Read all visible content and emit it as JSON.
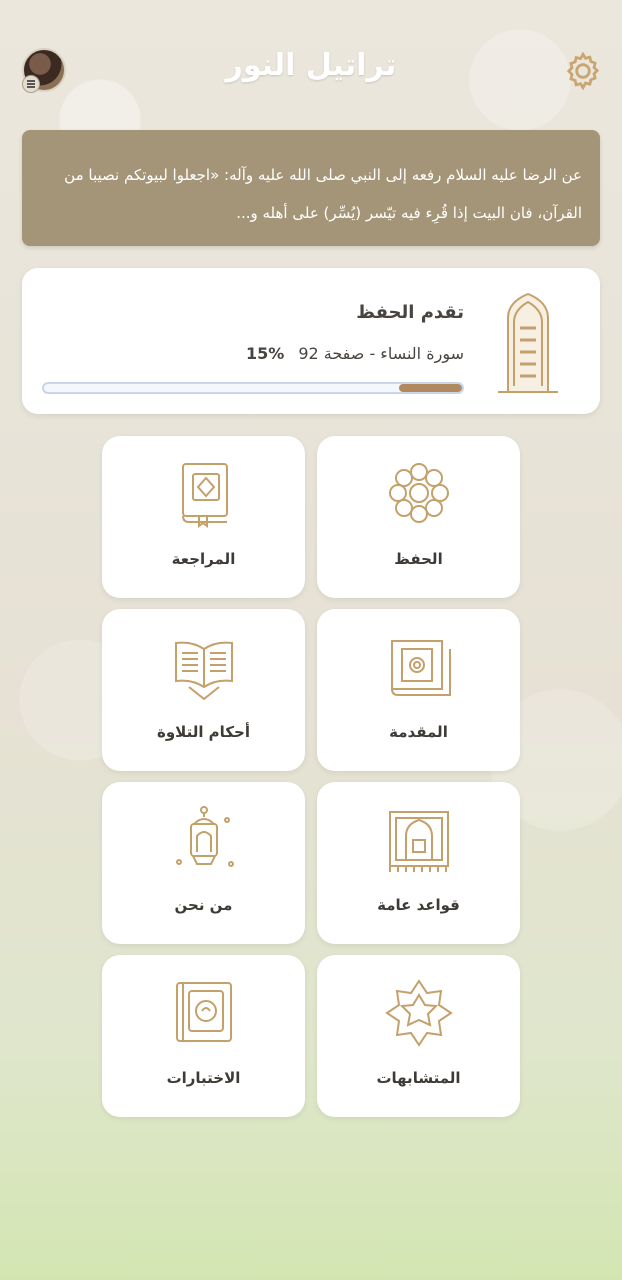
{
  "header": {
    "title": "تراتيل النور",
    "avatar_icon": "user-avatar",
    "menu_icon": "menu-icon",
    "settings_icon": "gear-icon"
  },
  "hadith": {
    "text": "عن الرضا عليه السلام رفعه إلى النبي صلى الله عليه وآله:  «اجعلوا لبيوتكم نصيبا من القرآن، فان البيت إذا قُرِء فيه تيّسر (يُسِّر) على أهله و..."
  },
  "progress": {
    "title": "تقدم الحفظ",
    "location": "سورة النساء - صفحة 92",
    "percent_label": "15%",
    "percent_value": 0.15
  },
  "tiles": [
    {
      "label": "الحفظ",
      "icon": "flower-icon"
    },
    {
      "label": "المراجعة",
      "icon": "book-closed-icon"
    },
    {
      "label": "المقدمة",
      "icon": "quran-book-icon"
    },
    {
      "label": "أحكام التلاوة",
      "icon": "open-book-icon"
    },
    {
      "label": "قواعد عامة",
      "icon": "mihrab-icon"
    },
    {
      "label": "من نحن",
      "icon": "lantern-icon"
    },
    {
      "label": "المتشابهات",
      "icon": "star-icon"
    },
    {
      "label": "الاختبارات",
      "icon": "quiz-book-icon"
    }
  ],
  "colors": {
    "accent_gold": "#b08a5e",
    "hadith_bg": "#a49578"
  }
}
